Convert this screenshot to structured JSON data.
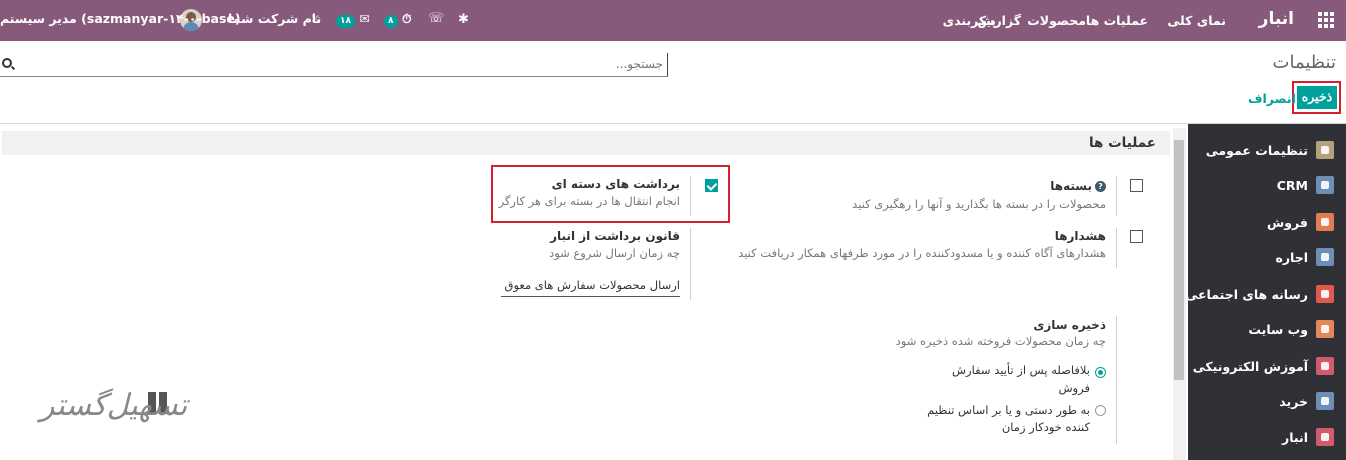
{
  "navbar": {
    "app_name": "انبار",
    "menu": [
      "نمای کلی",
      "عملیات ها",
      "محصولات",
      "گزارش",
      "پیکربندی"
    ],
    "company": "نام شرکت شما",
    "user": "مدیر سیستم (sazmanyar-۱۴-۰-base)",
    "messages_badge": "۱۸",
    "activities_badge": "۸"
  },
  "control_panel": {
    "title": "تنظیمات",
    "search_placeholder": "جستجو...",
    "save_label": "ذخیره",
    "discard_label": "انصراف"
  },
  "sidebar": {
    "items": [
      {
        "label": "تنظیمات عمومی",
        "icon": "gear-icon",
        "color": "#b4a17b"
      },
      {
        "label": "CRM",
        "icon": "handshake-icon",
        "color": "#6d8fb5"
      },
      {
        "label": "فروش",
        "icon": "chart-icon",
        "color": "#e27d53"
      },
      {
        "label": "اجاره",
        "icon": "rental-icon",
        "color": "#6d8fb5"
      },
      {
        "label": "رسانه های اجتماعی",
        "icon": "thumbs-up-icon",
        "color": "#e0584e"
      },
      {
        "label": "وب سایت",
        "icon": "globe-icon",
        "color": "#e2885a"
      },
      {
        "label": "آموزش الکترونیکی",
        "icon": "elearning-icon",
        "color": "#d25a6d"
      },
      {
        "label": "خرید",
        "icon": "card-icon",
        "color": "#6d8fb5"
      },
      {
        "label": "انبار",
        "icon": "box-icon",
        "color": "#d25a6d"
      }
    ]
  },
  "section": {
    "title": "عملیات ها",
    "settings": {
      "packages": {
        "title": "بسته‌ها",
        "desc": "محصولات را در بسته ها بگذارید و آنها را رهگیری کنید",
        "checked": false
      },
      "batch_picking": {
        "title": "برداشت های دسته ای",
        "desc": "انجام انتقال ها در بسته برای هر کارگر",
        "checked": true
      },
      "warnings": {
        "title": "هشدارها",
        "desc": "هشدارهای آگاه کننده و یا مسدودکننده را در مورد طرفهای همکار دریافت کنید",
        "checked": false
      },
      "removal_strategy": {
        "title": "قانون برداشت از انبار",
        "desc": "چه زمان ارسال شروع شود",
        "value": "ارسال محصولات سفارش های معوق به"
      },
      "reservation": {
        "title": "ذخیره سازی",
        "desc": "چه زمان محصولات فروخته شده ذخیره شود",
        "option1_line1": "بلافاصله پس از تأیید سفارش",
        "option1_line2": "فروش",
        "option2_line1": "به طور دستی و یا بر اساس تنظیم",
        "option2_line2": "کننده خودکار زمان"
      }
    }
  },
  "watermark": "تسهیل‌گستر",
  "colors": {
    "navbar": "#875a7b",
    "accent": "#00a09d",
    "sidebar": "#2f3136",
    "highlight": "#d61f2c"
  }
}
